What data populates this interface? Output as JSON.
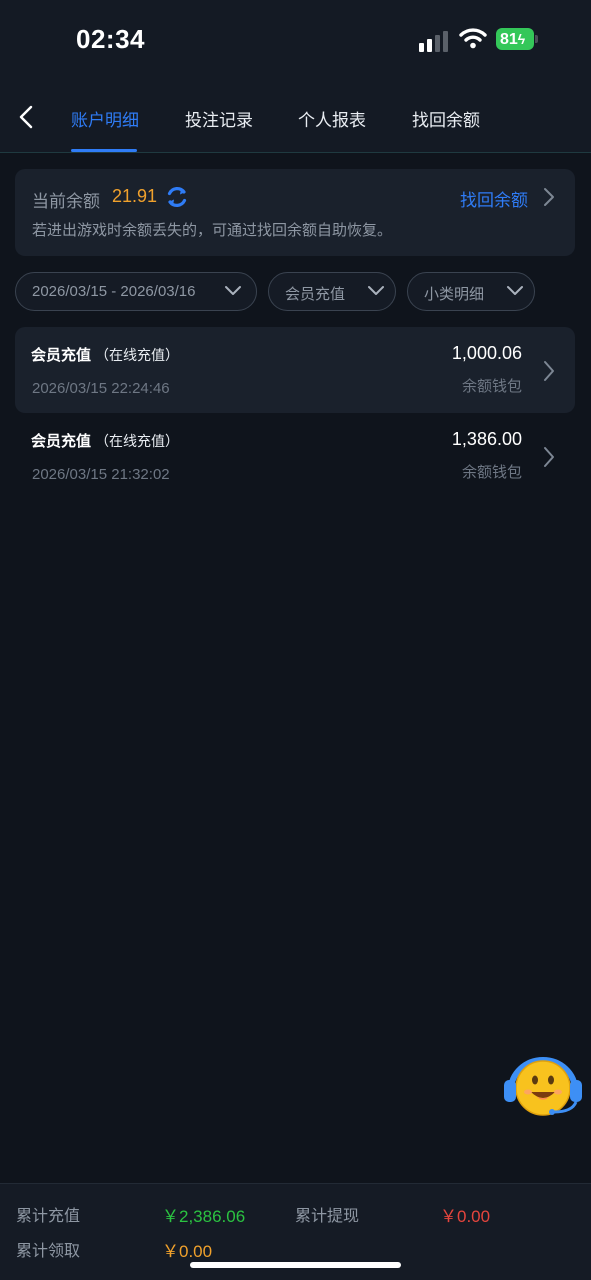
{
  "status_bar": {
    "time": "02:34",
    "battery": "81"
  },
  "nav": {
    "tabs": [
      {
        "label": "账户明细",
        "active": true
      },
      {
        "label": "投注记录",
        "active": false
      },
      {
        "label": "个人报表",
        "active": false
      },
      {
        "label": "找回余额",
        "active": false
      }
    ]
  },
  "balance": {
    "label": "当前余额",
    "value": "21.91",
    "recover_link": "找回余额",
    "hint": "若进出游戏时余额丢失的，可通过找回余额自助恢复。"
  },
  "filters": {
    "date_range": "2026/03/15 - 2026/03/16",
    "type": "会员充值",
    "subtype": "小类明细"
  },
  "records": [
    {
      "title": "会员充值",
      "subtitle": "（在线充值）",
      "time": "2026/03/15 22:24:46",
      "amount": "1,000.06",
      "wallet": "余额钱包"
    },
    {
      "title": "会员充值",
      "subtitle": "（在线充值）",
      "time": "2026/03/15 21:32:02",
      "amount": "1,386.00",
      "wallet": "余额钱包"
    }
  ],
  "summary": {
    "deposit_label": "累计充值",
    "deposit_value": "￥2,386.06",
    "withdraw_label": "累计提现",
    "withdraw_value": "￥0.00",
    "claim_label": "累计领取",
    "claim_value": "￥0.00"
  },
  "colors": {
    "accent": "#2f7cf6",
    "balance": "#f0a12c",
    "positive": "#2bc341",
    "negative": "#e5453d",
    "battery": "#34c759"
  },
  "icons": [
    "back-arrow-icon",
    "refresh-icon",
    "chevron-right-icon",
    "chevron-down-icon",
    "customer-service-icon",
    "signal-icon",
    "wifi-icon"
  ]
}
